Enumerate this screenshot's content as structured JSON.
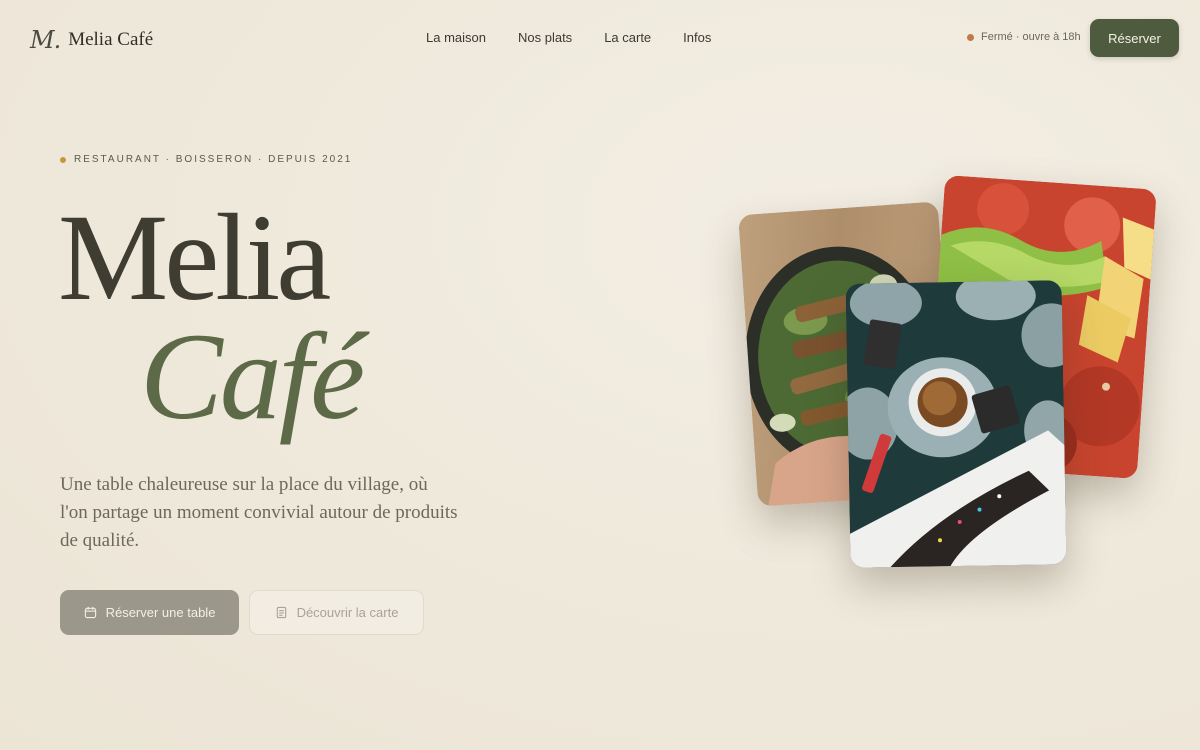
{
  "brand": {
    "mark": "M.",
    "name": "Melia Café"
  },
  "nav": {
    "items": [
      "La maison",
      "Nos plats",
      "La carte",
      "Infos"
    ]
  },
  "status": {
    "text": "Fermé · ouvre à 18h",
    "color": "#c07a4a"
  },
  "header_button": "Réserver",
  "hero": {
    "eyebrow": "RESTAURANT · BOISSERON · DEPUIS 2021",
    "title_line1": "Melia",
    "title_line2": "Café",
    "tagline": "Une table chaleureuse sur la place du village, où l'on partage un moment convivial autour de produits de qualité.",
    "primary_button": "Réserver une table",
    "secondary_button": "Découvrir la carte"
  },
  "colors": {
    "accent": "#4e5b3e",
    "title": "#3f3c32",
    "title_italic": "#5d6a48",
    "background": "#efe9dc"
  },
  "icons": {
    "primary": "calendar-icon",
    "secondary": "menu-card-icon"
  }
}
